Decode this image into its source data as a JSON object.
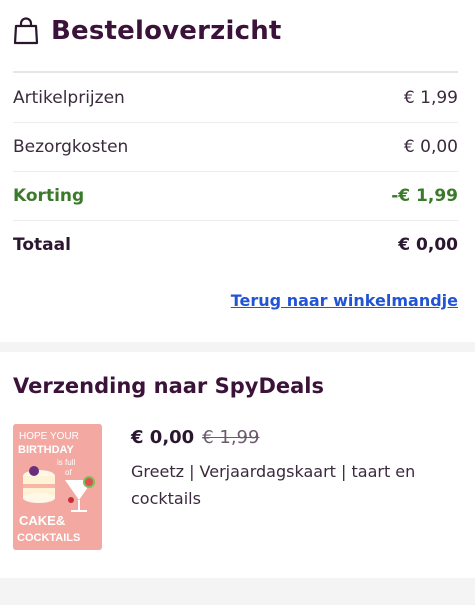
{
  "summary": {
    "title": "Besteloverzicht",
    "rows": [
      {
        "label": "Artikelprijzen",
        "value": "€ 1,99"
      },
      {
        "label": "Bezorgkosten",
        "value": "€ 0,00"
      },
      {
        "label": "Korting",
        "value": "-€ 1,99"
      },
      {
        "label": "Totaal",
        "value": "€ 0,00"
      }
    ],
    "back_link": "Terug naar winkelmandje"
  },
  "shipping": {
    "title": "Verzending naar SpyDeals",
    "item": {
      "price_now": "€ 0,00",
      "price_old": "€ 1,99",
      "name": "Greetz | Verjaardagskaart | taart en cocktails",
      "image_text": [
        "HOPE YOUR",
        "BIRTHDAY",
        "is full",
        "of",
        "CAKE&",
        "COCKTAILS"
      ]
    }
  },
  "colors": {
    "heading": "#3b1239",
    "discount": "#3c7a2b",
    "link": "#2255d6",
    "card_pink": "#f3a9a2"
  },
  "icons": {
    "bag": "shopping-bag-icon"
  }
}
